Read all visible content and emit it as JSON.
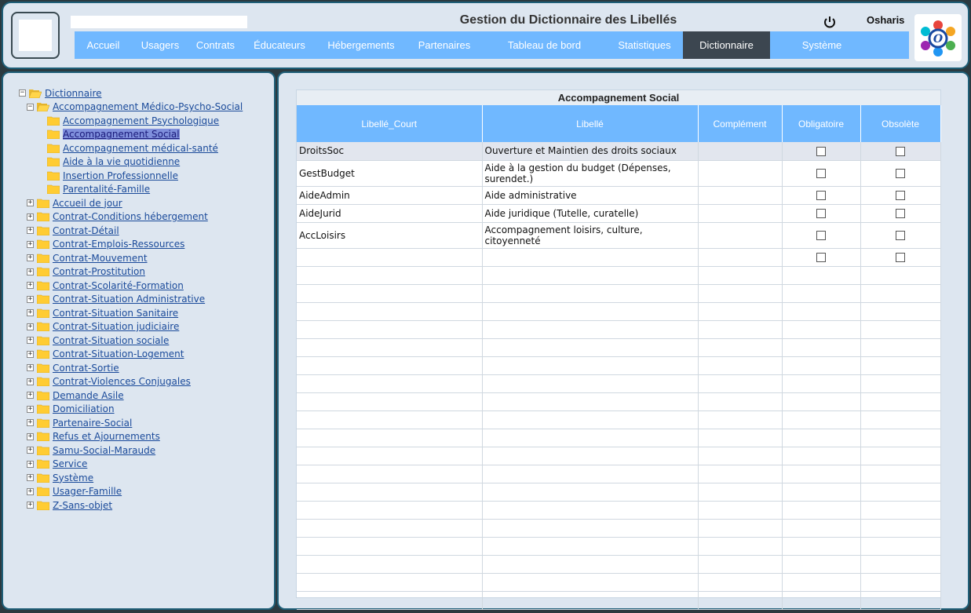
{
  "header": {
    "title": "Gestion du Dictionnaire des Libellés",
    "user": "Osharis",
    "search_value": ""
  },
  "nav": [
    {
      "label": "Accueil",
      "active": false
    },
    {
      "label": "Usagers",
      "active": false
    },
    {
      "label": "Contrats",
      "active": false
    },
    {
      "label": "Éducateurs",
      "active": false
    },
    {
      "label": "Hébergements",
      "active": false
    },
    {
      "label": "Partenaires",
      "active": false
    },
    {
      "label": "Tableau de bord",
      "active": false
    },
    {
      "label": "Statistiques",
      "active": false
    },
    {
      "label": "Dictionnaire",
      "active": true
    },
    {
      "label": "Système",
      "active": false
    }
  ],
  "tree": {
    "root": "Dictionnaire",
    "open_node": "Accompagnement Médico-Psycho-Social",
    "children": [
      {
        "label": "Accompagnement Psychologique",
        "selected": false
      },
      {
        "label": "Accompagnement Social",
        "selected": true
      },
      {
        "label": "Accompagnement médical-santé",
        "selected": false
      },
      {
        "label": "Aide à la vie quotidienne",
        "selected": false
      },
      {
        "label": "Insertion Professionnelle",
        "selected": false
      },
      {
        "label": "Parentalité-Famille",
        "selected": false
      }
    ],
    "nodes": [
      "Accueil de jour",
      "Contrat-Conditions hébergement",
      "Contrat-Détail",
      "Contrat-Emplois-Ressources",
      "Contrat-Mouvement",
      "Contrat-Prostitution",
      "Contrat-Scolarité-Formation",
      "Contrat-Situation Administrative",
      "Contrat-Situation Sanitaire",
      "Contrat-Situation judiciaire",
      "Contrat-Situation sociale",
      "Contrat-Situation-Logement",
      "Contrat-Sortie",
      "Contrat-Violences Conjugales",
      "Demande Asile",
      "Domiciliation",
      "Partenaire-Social",
      "Refus et Ajournements",
      "Samu-Social-Maraude",
      "Service",
      "Système",
      "Usager-Famille",
      "Z-Sans-objet"
    ]
  },
  "grid": {
    "title": "Accompagnement Social",
    "columns": [
      "Libellé_Court",
      "Libellé",
      "Complément",
      "Obligatoire",
      "Obsolète"
    ],
    "rows": [
      {
        "court": "DroitsSoc",
        "libelle": "Ouverture et Maintien des droits sociaux",
        "complement": "",
        "obligatoire": false,
        "obsolete": false
      },
      {
        "court": "GestBudget",
        "libelle": "Aide à la gestion du budget (Dépenses, surendet.)",
        "complement": "",
        "obligatoire": false,
        "obsolete": false
      },
      {
        "court": "AideAdmin",
        "libelle": "Aide administrative",
        "complement": "",
        "obligatoire": false,
        "obsolete": false
      },
      {
        "court": "AideJurid",
        "libelle": "Aide juridique (Tutelle, curatelle)",
        "complement": "",
        "obligatoire": false,
        "obsolete": false
      },
      {
        "court": "AccLoisirs",
        "libelle": "Accompagnement loisirs, culture, citoyenneté",
        "complement": "",
        "obligatoire": false,
        "obsolete": false
      },
      {
        "court": "",
        "libelle": "",
        "complement": "",
        "obligatoire": false,
        "obsolete": false
      }
    ],
    "empty_rows": 19
  },
  "colors": {
    "accent": "#70b8ff",
    "active_nav": "#3c4650",
    "panel_bg": "#dde6f0",
    "border": "#1f5f78",
    "selection": "#7f8fdc"
  }
}
